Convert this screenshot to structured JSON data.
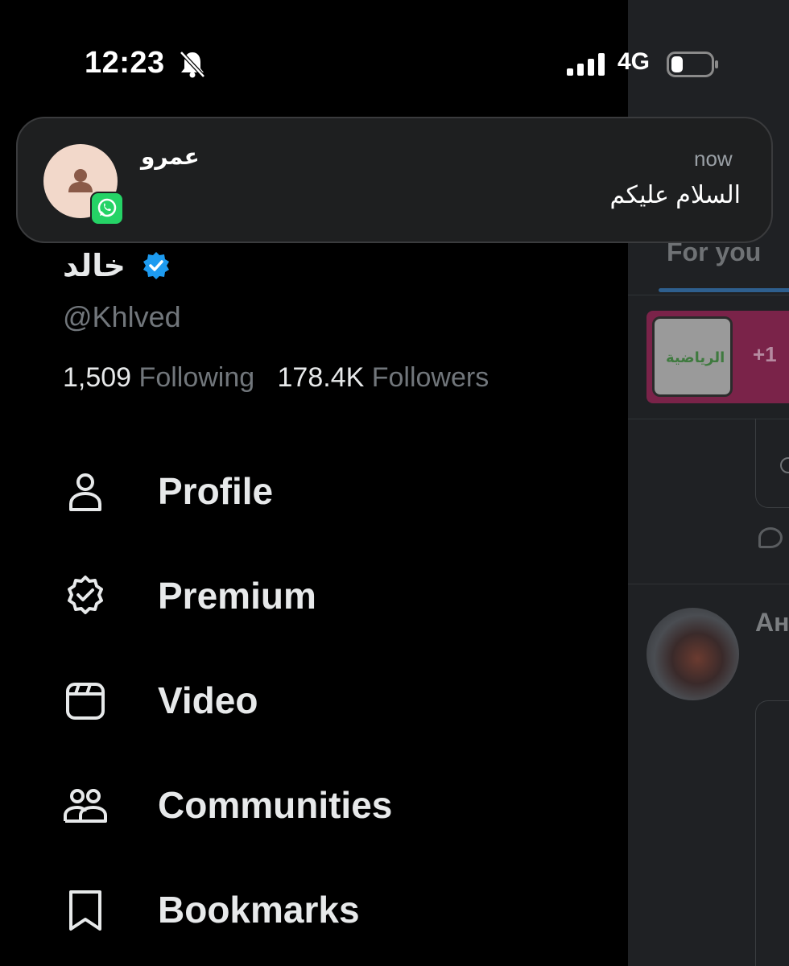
{
  "status_bar": {
    "time": "12:23",
    "network": "4G"
  },
  "notification": {
    "app_icon": "whatsapp-icon",
    "sender": "عمرو",
    "time": "now",
    "message": "السلام عليكم"
  },
  "profile": {
    "display_name": "خالد",
    "handle": "@Khlved",
    "following_count": "1,509",
    "following_label": "Following",
    "followers_count": "178.4K",
    "followers_label": "Followers"
  },
  "menu": {
    "items": [
      {
        "label": "Profile",
        "icon": "person-icon"
      },
      {
        "label": "Premium",
        "icon": "verified-badge-icon"
      },
      {
        "label": "Video",
        "icon": "video-icon"
      },
      {
        "label": "Communities",
        "icon": "communities-icon"
      },
      {
        "label": "Bookmarks",
        "icon": "bookmark-icon"
      }
    ]
  },
  "background_feed": {
    "tab_label": "For you",
    "promo_text": "+1",
    "author_initials": "Ан"
  },
  "colors": {
    "accent": "#1d9bf0",
    "whatsapp": "#25d366",
    "background": "#000000"
  }
}
